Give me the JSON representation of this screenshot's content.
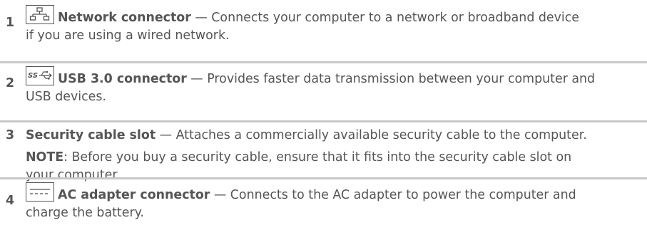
{
  "items": [
    {
      "number": "1",
      "icon": "network-icon",
      "term": "Network connector",
      "line1": " — Connects your computer to a network or broadband device",
      "line2": "if you are using a wired network."
    },
    {
      "number": "2",
      "icon": "usb-ss-icon",
      "term": "USB 3.0 connector",
      "line1": " — Provides faster data transmission between your computer and",
      "line2": "USB devices."
    },
    {
      "number": "3",
      "term": "Security cable slot",
      "line1": " — Attaches a commercially available security cable to the computer.",
      "note_label": "NOTE",
      "note_line1": ": Before you buy a security cable, ensure that it fits into the security cable slot on",
      "note_line2": "your computer."
    },
    {
      "number": "4",
      "icon": "ac-adapter-icon",
      "term": "AC adapter connector",
      "line1": " — Connects to the AC adapter to power the computer and",
      "line2": "charge the battery."
    }
  ]
}
